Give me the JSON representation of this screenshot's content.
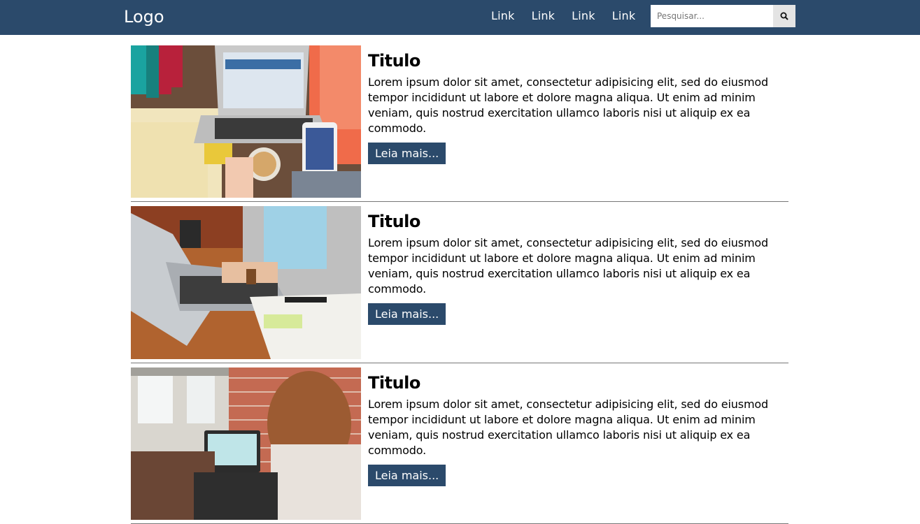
{
  "navbar": {
    "logo": "Logo",
    "links": [
      "Link",
      "Link",
      "Link",
      "Link"
    ],
    "search": {
      "placeholder": "Pesquisar...",
      "value": ""
    },
    "brand_color": "#2b4a6b"
  },
  "posts": [
    {
      "title": "Titulo",
      "text": "Lorem ipsum dolor sit amet, consectetur adipisicing elit, sed do eiusmod tempor incididunt ut labore et dolore magna aliqua. Ut enim ad minim veniam, quis nostrud exercitation ullamco laboris nisi ut aliquip ex ea commodo.",
      "button": "Leia mais...",
      "image": "desk-laptop-phone-photo"
    },
    {
      "title": "Titulo",
      "text": "Lorem ipsum dolor sit amet, consectetur adipisicing elit, sed do eiusmod tempor incididunt ut labore et dolore magna aliqua. Ut enim ad minim veniam, quis nostrud exercitation ullamco laboris nisi ut aliquip ex ea commodo.",
      "button": "Leia mais...",
      "image": "typing-on-laptop-photo"
    },
    {
      "title": "Titulo",
      "text": "Lorem ipsum dolor sit amet, consectetur adipisicing elit, sed do eiusmod tempor incididunt ut labore et dolore magna aliqua. Ut enim ad minim veniam, quis nostrud exercitation ullamco laboris nisi ut aliquip ex ea commodo.",
      "button": "Leia mais...",
      "image": "woman-brick-wall-laptop-photo"
    }
  ]
}
